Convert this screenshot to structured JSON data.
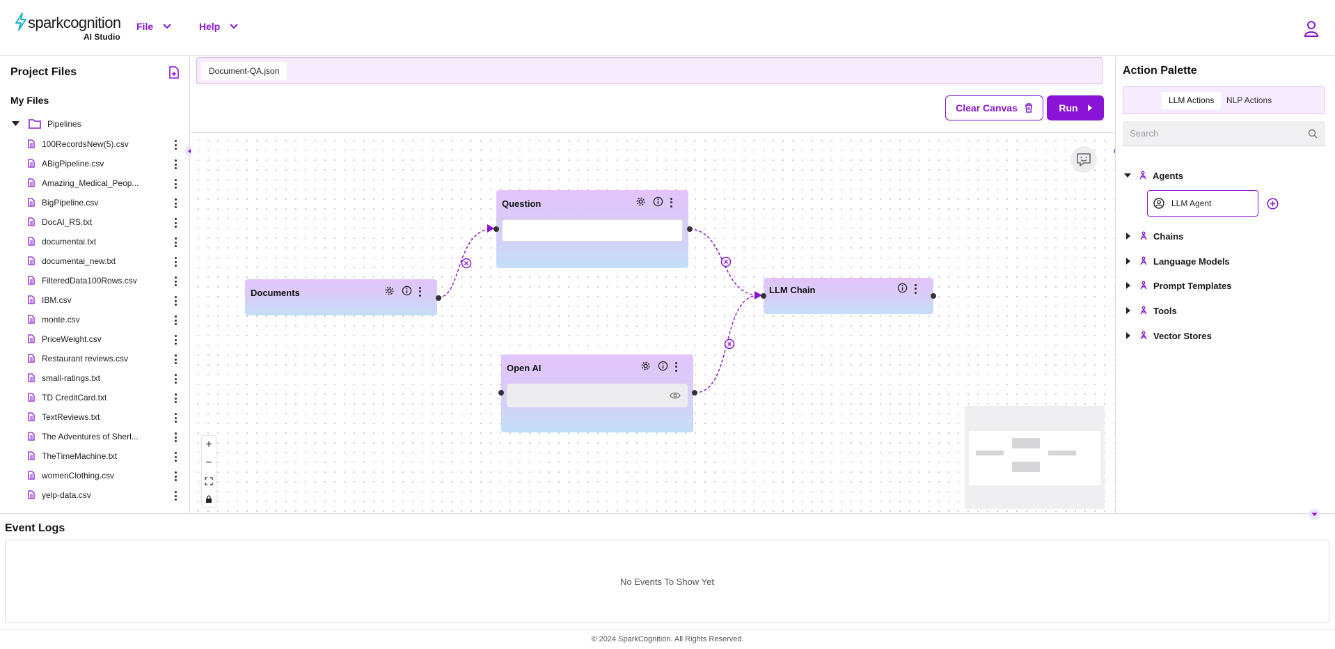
{
  "header": {
    "brand": "sparkcognition",
    "product": "AI Studio",
    "menus": [
      {
        "label": "File"
      },
      {
        "label": "Help"
      }
    ]
  },
  "project_files": {
    "title": "Project Files",
    "section": "My Files",
    "folder": "Pipelines",
    "files": [
      "100RecordsNew(5).csv",
      "ABigPipeline.csv",
      "Amazing_Medical_Peop...",
      "BigPipeline.csv",
      "DocAI_RS.txt",
      "documentai.txt",
      "documentai_new.txt",
      "FilteredData100Rows.csv",
      "IBM.csv",
      "monte.csv",
      "PriceWeight.csv",
      "Restaurant reviews.csv",
      "small-ratings.txt",
      "TD CreditCard.txt",
      "TextReviews.txt",
      "The Adventures of Sherl...",
      "TheTimeMachine.txt",
      "womenClothing.csv",
      "yelp-data.csv"
    ]
  },
  "editor": {
    "open_tab": "Document-QA.json",
    "clear_label": "Clear Canvas",
    "run_label": "Run"
  },
  "nodes": {
    "documents": "Documents",
    "question": "Question",
    "openai": "Open AI",
    "llm_chain": "LLM Chain"
  },
  "palette": {
    "title": "Action Palette",
    "tabs": [
      "LLM Actions",
      "NLP Actions"
    ],
    "search_placeholder": "Search",
    "categories": [
      "Agents",
      "Chains",
      "Language Models",
      "Prompt Templates",
      "Tools",
      "Vector Stores"
    ],
    "agent_item": "LLM Agent"
  },
  "logs": {
    "title": "Event Logs",
    "empty": "No Events To Show Yet"
  },
  "footer": "© 2024 SparkCognition. All Rights Reserved.",
  "colors": {
    "accent": "#8a13d6",
    "node_top": "#e2c4fb",
    "node_bottom": "#c5def7"
  }
}
